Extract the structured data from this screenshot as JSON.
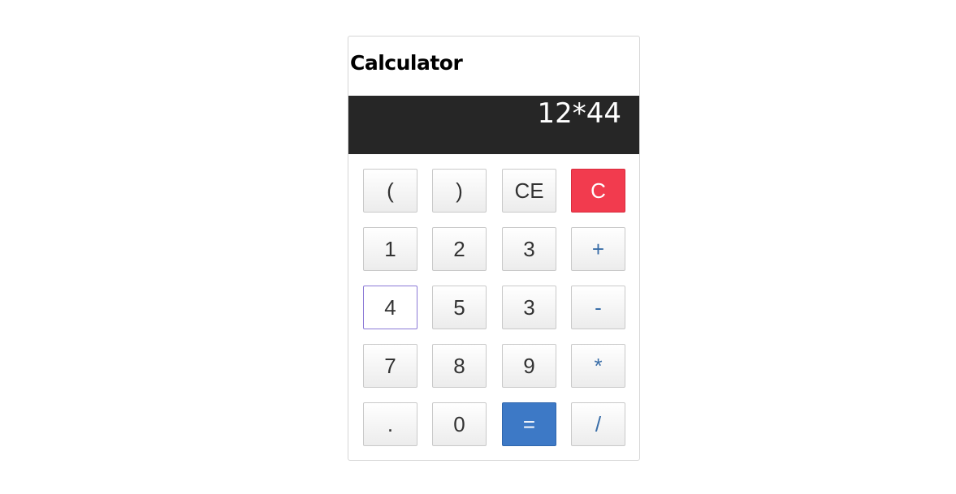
{
  "app": {
    "title": "Calculator"
  },
  "display": {
    "value": "12*44"
  },
  "keys": [
    [
      "(",
      ")",
      "CE",
      "C"
    ],
    [
      "1",
      "2",
      "3",
      "+"
    ],
    [
      "4",
      "5",
      "3",
      "-"
    ],
    [
      "7",
      "8",
      "9",
      "*"
    ],
    [
      ".",
      "0",
      "=",
      "/"
    ]
  ],
  "colors": {
    "display_bg": "#262626",
    "clear_button": "#f23b4e",
    "equals_button": "#3d79c6",
    "operator_text": "#3a6ea8"
  }
}
